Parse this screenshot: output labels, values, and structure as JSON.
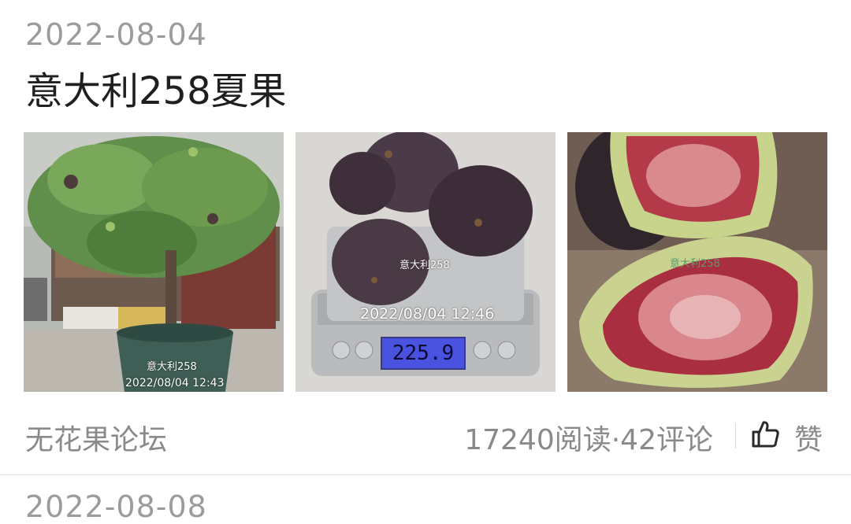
{
  "post": {
    "date": "2022-08-04",
    "title": "意大利258夏果",
    "photos": [
      {
        "watermark": "意大利258",
        "timestamp": "2022/08/04 12:43"
      },
      {
        "watermark": "意大利258",
        "timestamp": "2022/08/04 12:46",
        "scale_reading": "225.9"
      },
      {
        "watermark": "意大利258"
      }
    ],
    "source": "无花果论坛",
    "stats": "17240阅读·42评论",
    "like_label": "赞"
  },
  "next_post": {
    "date": "2022-08-08"
  },
  "icons": {
    "like": "thumbs-up-icon"
  },
  "colors": {
    "date": "#9b9b9b",
    "title": "#1f1f1f",
    "meta": "#8a8a8a"
  }
}
